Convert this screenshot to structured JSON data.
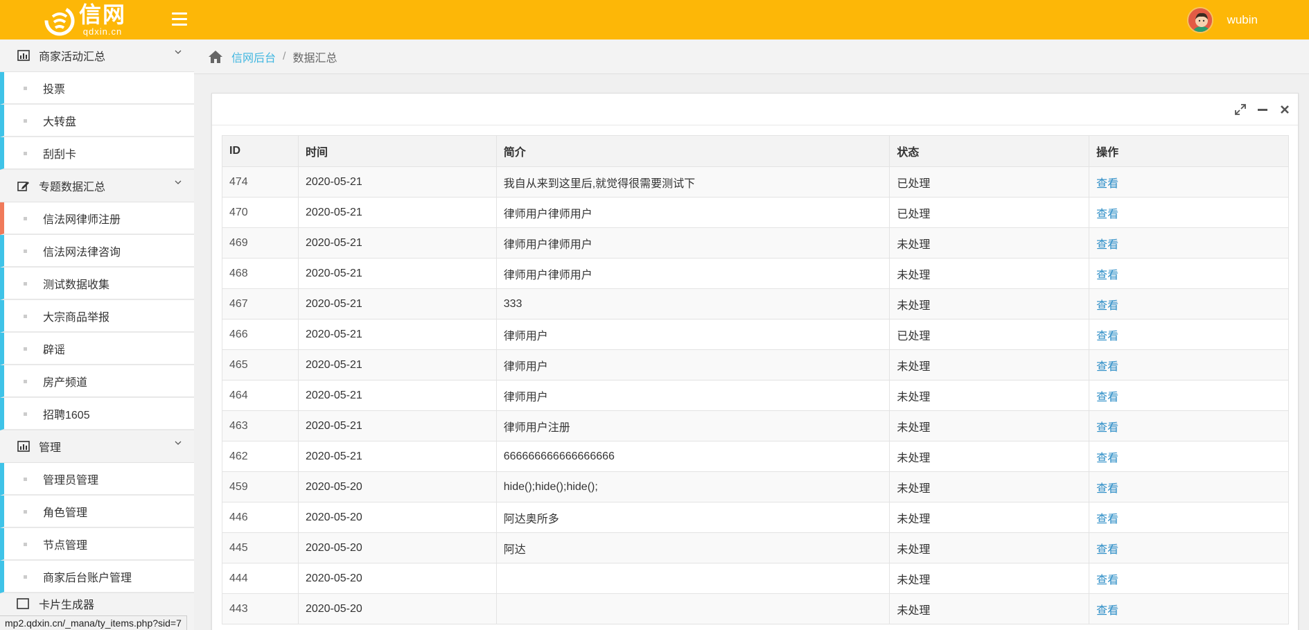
{
  "header": {
    "logo_cn": "信网",
    "logo_en": "qdxin.cn",
    "user_name": "wubin",
    "accent": "#fdb707"
  },
  "sidebar": {
    "groups": [
      {
        "label": "商家活动汇总",
        "icon": "bar-chart-icon",
        "items": [
          "投票",
          "大转盘",
          "刮刮卡"
        ]
      },
      {
        "label": "专题数据汇总",
        "icon": "edit-icon",
        "items": [
          "信法网律师注册",
          "信法网法律咨询",
          "测试数据收集",
          "大宗商品举报",
          "辟谣",
          "房产频道",
          "招聘1605"
        ]
      },
      {
        "label": "管理",
        "icon": "bar-chart-icon",
        "items": [
          "管理员管理",
          "角色管理",
          "节点管理",
          "商家后台账户管理"
        ]
      }
    ],
    "partial_label": "卡片生成器"
  },
  "breadcrumb": {
    "home": "信网后台",
    "separator": "/",
    "current": "数据汇总"
  },
  "table": {
    "headers": [
      "ID",
      "时间",
      "简介",
      "状态",
      "操作"
    ],
    "rows": [
      {
        "id": "474",
        "time": "2020-05-21",
        "desc": "我自从来到这里后,就觉得很需要测试下",
        "status": "已处理",
        "action": "查看"
      },
      {
        "id": "470",
        "time": "2020-05-21",
        "desc": "律师用户律师用户",
        "status": "已处理",
        "action": "查看"
      },
      {
        "id": "469",
        "time": "2020-05-21",
        "desc": "律师用户律师用户",
        "status": "未处理",
        "action": "查看"
      },
      {
        "id": "468",
        "time": "2020-05-21",
        "desc": "律师用户律师用户",
        "status": "未处理",
        "action": "查看"
      },
      {
        "id": "467",
        "time": "2020-05-21",
        "desc": "333",
        "status": "未处理",
        "action": "查看"
      },
      {
        "id": "466",
        "time": "2020-05-21",
        "desc": "律师用户",
        "status": "已处理",
        "action": "查看"
      },
      {
        "id": "465",
        "time": "2020-05-21",
        "desc": "律师用户",
        "status": "未处理",
        "action": "查看"
      },
      {
        "id": "464",
        "time": "2020-05-21",
        "desc": "律师用户",
        "status": "未处理",
        "action": "查看"
      },
      {
        "id": "463",
        "time": "2020-05-21",
        "desc": "律师用户注册",
        "status": "未处理",
        "action": "查看"
      },
      {
        "id": "462",
        "time": "2020-05-21",
        "desc": "666666666666666666",
        "status": "未处理",
        "action": "查看"
      },
      {
        "id": "459",
        "time": "2020-05-20",
        "desc": "hide();hide();hide();",
        "status": "未处理",
        "action": "查看"
      },
      {
        "id": "446",
        "time": "2020-05-20",
        "desc": "阿达奥所多",
        "status": "未处理",
        "action": "查看"
      },
      {
        "id": "445",
        "time": "2020-05-20",
        "desc": "阿达",
        "status": "未处理",
        "action": "查看"
      },
      {
        "id": "444",
        "time": "2020-05-20",
        "desc": "",
        "status": "未处理",
        "action": "查看"
      },
      {
        "id": "443",
        "time": "2020-05-20",
        "desc": "",
        "status": "未处理",
        "action": "查看"
      }
    ]
  },
  "statusbar": {
    "url": "mp2.qdxin.cn/_mana/ty_items.php?sid=7"
  }
}
